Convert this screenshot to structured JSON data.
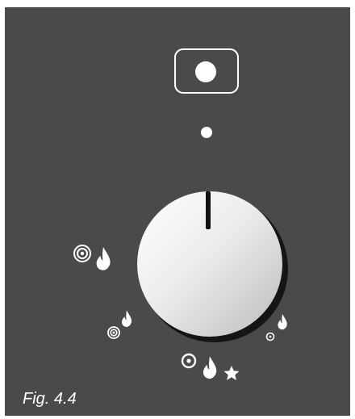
{
  "figure": {
    "caption": "Fig. 4.4"
  },
  "colors": {
    "panel": "#4a4a4a",
    "foreground": "#ffffff",
    "knob_shadow": "#151515"
  },
  "controls": {
    "ignition_button": {
      "icon": "ignition-button-icon"
    },
    "indicator_light": {
      "icon": "indicator-dot-icon"
    },
    "control_knob": {
      "indicator": "knob-marker-line"
    }
  },
  "positions": [
    {
      "id": "large-flame",
      "icons": [
        "large-ring-icon",
        "large-flame-icon"
      ]
    },
    {
      "id": "small-flame",
      "icons": [
        "medium-ring-icon",
        "small-flame-icon"
      ]
    },
    {
      "id": "ignition",
      "icons": [
        "ring-icon",
        "flame-icon",
        "spark-star-icon"
      ]
    },
    {
      "id": "pilot",
      "icons": [
        "small-ring-icon",
        "small-flame-icon"
      ]
    }
  ]
}
